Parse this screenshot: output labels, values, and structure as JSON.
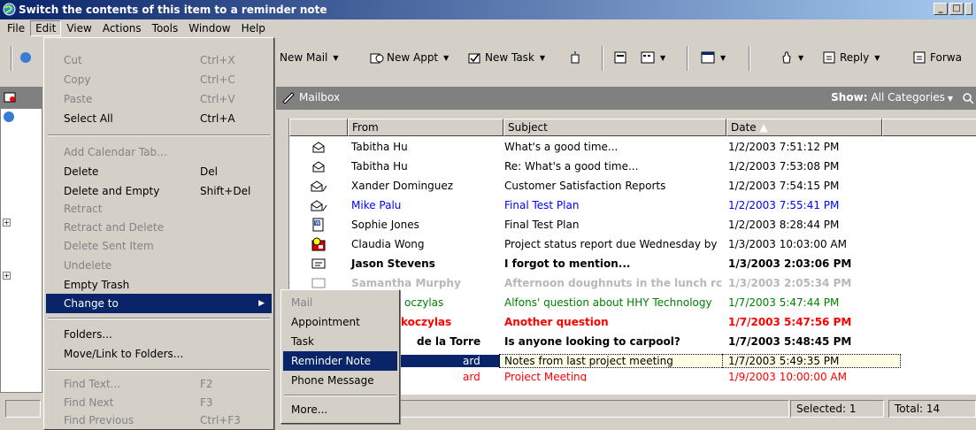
{
  "window": {
    "title": "Switch the contents of this item to a reminder note"
  },
  "menubar": [
    "File",
    "Edit",
    "View",
    "Actions",
    "Tools",
    "Window",
    "Help"
  ],
  "toolbar": {
    "new_mail": "New Mail",
    "new_appt": "New Appt",
    "new_task": "New Task",
    "reply": "Reply",
    "forward": "Forwa"
  },
  "mailbox": {
    "title": "Mailbox",
    "show_label": "Show:",
    "show_value": "All Categories"
  },
  "columns": {
    "from": "From",
    "subject": "Subject",
    "date": "Date"
  },
  "messages": [
    {
      "icon": "envelope-open-icon",
      "from": "Tabitha Hu",
      "subject": "What's a good time...",
      "date": "1/2/2003 7:51:12 PM"
    },
    {
      "icon": "envelope-open-icon",
      "from": "Tabitha Hu",
      "subject": "Re: What's a good time...",
      "date": "1/2/2003 7:53:08 PM"
    },
    {
      "icon": "envelope-edit-icon",
      "from": "Xander Dominguez",
      "subject": "Customer Satisfaction Reports",
      "date": "1/2/2003 7:54:15 PM"
    },
    {
      "icon": "envelope-edit-icon",
      "from": "Mike Palu",
      "subject": "Final Test Plan",
      "date": "1/2/2003 7:55:41 PM"
    },
    {
      "icon": "word-document-icon",
      "from": "Sophie Jones",
      "subject": "Final Test Plan",
      "date": "1/2/2003 8:28:44 PM"
    },
    {
      "icon": "reminder-clock-icon",
      "from": "Claudia Wong",
      "subject": "Project status report due Wednesday by",
      "date": "1/3/2003 10:03:00 AM"
    },
    {
      "icon": "envelope-closed-icon",
      "from": "Jason Stevens",
      "subject": "I forgot to mention...",
      "date": "1/3/2003 2:03:06 PM"
    },
    {
      "icon": "envelope-closed-icon",
      "from": "Samantha Murphy",
      "subject": "Afternoon doughnuts in the lunch rc",
      "date": "1/3/2003 2:05:34 PM"
    },
    {
      "icon": "",
      "from": "oczylas",
      "subject": "Alfons' question about HHY Technology",
      "date": "1/7/2003 5:47:44 PM"
    },
    {
      "icon": "",
      "from": "koczylas",
      "subject": "Another question",
      "date": "1/7/2003 5:47:56 PM"
    },
    {
      "icon": "",
      "from": "de la Torre",
      "subject": "Is anyone looking to carpool?",
      "date": "1/7/2003 5:48:45 PM"
    },
    {
      "icon": "",
      "from": "ard",
      "subject": "Notes from last project meeting",
      "date": "1/7/2003 5:49:35 PM"
    },
    {
      "icon": "",
      "from": "ard",
      "subject": "Project Meeting",
      "date": "1/9/2003 10:00:00 AM"
    }
  ],
  "edit_menu": {
    "cut": "Cut",
    "cut_sc": "Ctrl+X",
    "copy": "Copy",
    "copy_sc": "Ctrl+C",
    "paste": "Paste",
    "paste_sc": "Ctrl+V",
    "select_all": "Select All",
    "select_all_sc": "Ctrl+A",
    "add_calendar_tab": "Add Calendar Tab...",
    "delete": "Delete",
    "delete_sc": "Del",
    "delete_and_empty": "Delete and Empty",
    "delete_and_empty_sc": "Shift+Del",
    "retract": "Retract",
    "retract_and_delete": "Retract and Delete",
    "delete_sent_item": "Delete Sent Item",
    "undelete": "Undelete",
    "empty_trash": "Empty Trash",
    "change_to": "Change to",
    "folders": "Folders...",
    "move_link": "Move/Link to Folders...",
    "find_text": "Find Text...",
    "find_text_sc": "F2",
    "find_next": "Find Next",
    "find_next_sc": "F3",
    "find_previous": "Find Previous",
    "find_previous_sc": "Ctrl+F3"
  },
  "change_to_menu": {
    "mail": "Mail",
    "appointment": "Appointment",
    "task": "Task",
    "reminder_note": "Reminder Note",
    "phone_message": "Phone Message",
    "more": "More..."
  },
  "status": {
    "selected": "Selected: 1",
    "total": "Total: 14"
  },
  "colors": {
    "highlight": "#0a246a",
    "face": "#d4d0c8",
    "blue_text": "#0000ff",
    "green_text": "#008000",
    "red_text": "#ff0000"
  }
}
